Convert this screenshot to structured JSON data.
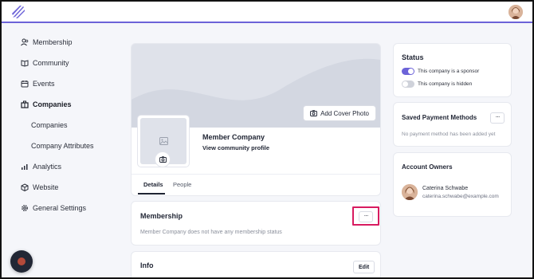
{
  "sidebar": {
    "items": [
      {
        "label": "Membership",
        "icon": "users-icon"
      },
      {
        "label": "Community",
        "icon": "book-icon"
      },
      {
        "label": "Events",
        "icon": "calendar-icon"
      },
      {
        "label": "Companies",
        "icon": "building-icon",
        "active": true
      },
      {
        "label": "Companies",
        "icon": "",
        "sub": true
      },
      {
        "label": "Company Attributes",
        "icon": "",
        "sub": true
      },
      {
        "label": "Analytics",
        "icon": "bar-chart-icon"
      },
      {
        "label": "Website",
        "icon": "cube-icon"
      },
      {
        "label": "General Settings",
        "icon": "gear-icon"
      }
    ]
  },
  "profile": {
    "add_cover_label": "Add Cover Photo",
    "company_name": "Member Company",
    "view_profile_label": "View community profile",
    "tabs": [
      {
        "label": "Details",
        "active": true
      },
      {
        "label": "People",
        "active": false
      }
    ]
  },
  "membership": {
    "title": "Membership",
    "menu_label": "···",
    "status_text": "Member Company does not have any membership status"
  },
  "info": {
    "title": "Info",
    "edit_label": "Edit"
  },
  "status": {
    "title": "Status",
    "toggles": [
      {
        "label": "This company is a sponsor",
        "on": true
      },
      {
        "label": "This company is hidden",
        "on": false
      }
    ]
  },
  "payment": {
    "title": "Saved Payment Methods",
    "menu_label": "···",
    "empty_text": "No payment method has been added yet"
  },
  "owners": {
    "title": "Account Owners",
    "list": [
      {
        "name": "Caterina Schwabe",
        "email": "caterina.schwabe@example.com"
      }
    ]
  },
  "colors": {
    "accent": "#6c63d8",
    "highlight": "#d81b60",
    "toggle_on": "#6c63d8",
    "toggle_off": "#cfd2da"
  }
}
